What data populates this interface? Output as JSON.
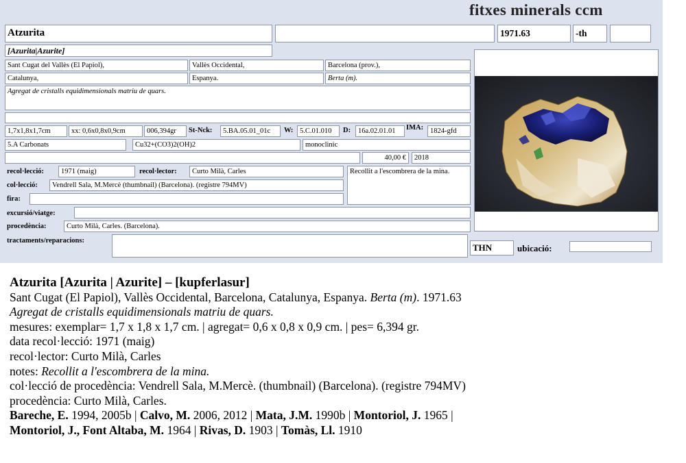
{
  "header": {
    "site_title": "fitxes minerals ccm"
  },
  "card": {
    "name": "Atzurita",
    "name_variants": "[Azurita|Azurite]",
    "field_blank_1": "",
    "catalog_no": "1971.63",
    "th_label": "-th",
    "field_blank_2": "",
    "locality": [
      "Sant Cugat del Vallès (El Papiol),",
      "Vallès Occidental,",
      "Barcelona (prov.),",
      "Catalunya,",
      "Espanya.",
      "Berta (m)."
    ],
    "description": "Agregat de cristalls equidimensionals matriu de quars.",
    "measure_specimen": "1,7x1,8x1,7cm",
    "measure_aggregate": "xx: 0,6x0,8x0,9cm",
    "weight": "006,394gr",
    "st_nck_label": "St-Nck:",
    "st_nck_value": "5.BA.05.01_01c",
    "w_label": "W:",
    "w_value": "5.C.01.010",
    "d_label": "D:",
    "d_value": "16a.02.01.01",
    "ima_label": "IMA:",
    "ima_value": "1824-gfd",
    "class": "5.A Carbonats",
    "formula": "Cu32+(CO3)2(OH)2",
    "system": "monoclinic",
    "price": "40,00 €",
    "year": "2018",
    "recoleccio_label": "recol·lecció:",
    "recoleccio_value": "1971 (maig)",
    "recolector_label": "recol·lector:",
    "recolector_value": "Curto Milà, Carles",
    "notes": "Recollit a l'escombrera de la mina.",
    "colleccio_label": "col·lecció:",
    "colleccio_value": "Vendrell Sala, M.Mercè (thumbnail) (Barcelona). (registre 794MV)",
    "fira_label": "fira:",
    "fira_value": "",
    "excursio_label": "excursió/viatge:",
    "excursio_value": "",
    "procedencia_label": "procedència:",
    "procedencia_value": "Curto Milà, Carles. (Barcelona).",
    "tractaments_label": "tractaments/reparacions:",
    "tractaments_value": "",
    "thn_label": "THN",
    "ubicacio_label": "ubicació:",
    "ubicacio_value": ""
  },
  "summary": {
    "heading": "Atzurita [Azurita | Azurite] – [kupferlasur]",
    "locality_line_plain": "Sant Cugat (El Papiol), Vallès Occidental, Barcelona, Catalunya, Espanya. ",
    "locality_line_italic": "Berta (m)",
    "locality_line_end": ". 1971.63",
    "description": "Agregat de cristalls equidimensionals matriu de quars.",
    "mesures": "mesures: exemplar= 1,7 x 1,8 x 1,7 cm. | agregat= 0,6 x 0,8 x 0,9 cm. | pes= 6,394 gr.",
    "data_recoleccio": "data recol·lecció:  1971 (maig)",
    "recolector": "recol·lector: Curto Milà, Carles",
    "notes_label": "notes: ",
    "notes_value": "Recollit a l'escombrera de la mina.",
    "colleccio": "col·lecció de procedència: Vendrell Sala, M.Mercè. (thumbnail) (Barcelona). (registre 794MV)",
    "procedencia": "procedència: Curto Milà, Carles.",
    "bibliography": [
      {
        "author": "Bareche, E.",
        "years": "1994, 2005b"
      },
      {
        "author": "Calvo, M.",
        "years": "2006, 2012"
      },
      {
        "author": "Mata, J.M.",
        "years": "1990b"
      },
      {
        "author": "Montoriol, J.",
        "years": "1965"
      },
      {
        "author": "Montoriol, J., Font Altaba, M.",
        "years": "1964"
      },
      {
        "author": "Rivas, D.",
        "years": "1903"
      },
      {
        "author": "Tomàs, Ll.",
        "years": "1910"
      }
    ]
  }
}
